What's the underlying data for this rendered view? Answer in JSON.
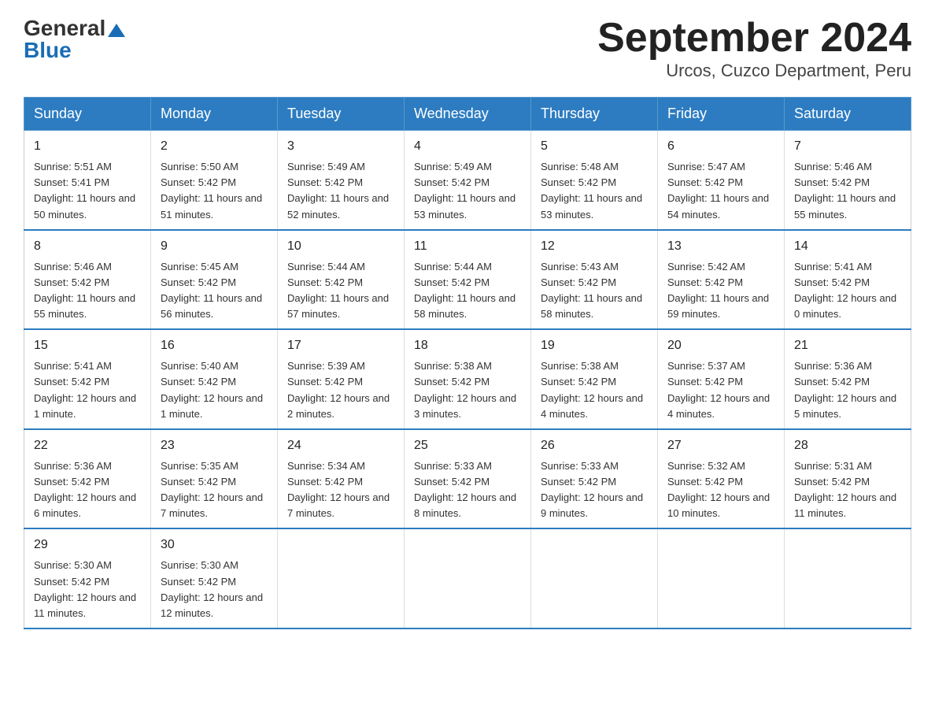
{
  "header": {
    "logo": {
      "text_general": "General",
      "triangle_alt": "blue triangle",
      "text_blue": "Blue"
    },
    "title": "September 2024",
    "subtitle": "Urcos, Cuzco Department, Peru"
  },
  "calendar": {
    "days_of_week": [
      "Sunday",
      "Monday",
      "Tuesday",
      "Wednesday",
      "Thursday",
      "Friday",
      "Saturday"
    ],
    "weeks": [
      [
        {
          "date": "1",
          "sunrise": "Sunrise: 5:51 AM",
          "sunset": "Sunset: 5:41 PM",
          "daylight": "Daylight: 11 hours and 50 minutes."
        },
        {
          "date": "2",
          "sunrise": "Sunrise: 5:50 AM",
          "sunset": "Sunset: 5:42 PM",
          "daylight": "Daylight: 11 hours and 51 minutes."
        },
        {
          "date": "3",
          "sunrise": "Sunrise: 5:49 AM",
          "sunset": "Sunset: 5:42 PM",
          "daylight": "Daylight: 11 hours and 52 minutes."
        },
        {
          "date": "4",
          "sunrise": "Sunrise: 5:49 AM",
          "sunset": "Sunset: 5:42 PM",
          "daylight": "Daylight: 11 hours and 53 minutes."
        },
        {
          "date": "5",
          "sunrise": "Sunrise: 5:48 AM",
          "sunset": "Sunset: 5:42 PM",
          "daylight": "Daylight: 11 hours and 53 minutes."
        },
        {
          "date": "6",
          "sunrise": "Sunrise: 5:47 AM",
          "sunset": "Sunset: 5:42 PM",
          "daylight": "Daylight: 11 hours and 54 minutes."
        },
        {
          "date": "7",
          "sunrise": "Sunrise: 5:46 AM",
          "sunset": "Sunset: 5:42 PM",
          "daylight": "Daylight: 11 hours and 55 minutes."
        }
      ],
      [
        {
          "date": "8",
          "sunrise": "Sunrise: 5:46 AM",
          "sunset": "Sunset: 5:42 PM",
          "daylight": "Daylight: 11 hours and 55 minutes."
        },
        {
          "date": "9",
          "sunrise": "Sunrise: 5:45 AM",
          "sunset": "Sunset: 5:42 PM",
          "daylight": "Daylight: 11 hours and 56 minutes."
        },
        {
          "date": "10",
          "sunrise": "Sunrise: 5:44 AM",
          "sunset": "Sunset: 5:42 PM",
          "daylight": "Daylight: 11 hours and 57 minutes."
        },
        {
          "date": "11",
          "sunrise": "Sunrise: 5:44 AM",
          "sunset": "Sunset: 5:42 PM",
          "daylight": "Daylight: 11 hours and 58 minutes."
        },
        {
          "date": "12",
          "sunrise": "Sunrise: 5:43 AM",
          "sunset": "Sunset: 5:42 PM",
          "daylight": "Daylight: 11 hours and 58 minutes."
        },
        {
          "date": "13",
          "sunrise": "Sunrise: 5:42 AM",
          "sunset": "Sunset: 5:42 PM",
          "daylight": "Daylight: 11 hours and 59 minutes."
        },
        {
          "date": "14",
          "sunrise": "Sunrise: 5:41 AM",
          "sunset": "Sunset: 5:42 PM",
          "daylight": "Daylight: 12 hours and 0 minutes."
        }
      ],
      [
        {
          "date": "15",
          "sunrise": "Sunrise: 5:41 AM",
          "sunset": "Sunset: 5:42 PM",
          "daylight": "Daylight: 12 hours and 1 minute."
        },
        {
          "date": "16",
          "sunrise": "Sunrise: 5:40 AM",
          "sunset": "Sunset: 5:42 PM",
          "daylight": "Daylight: 12 hours and 1 minute."
        },
        {
          "date": "17",
          "sunrise": "Sunrise: 5:39 AM",
          "sunset": "Sunset: 5:42 PM",
          "daylight": "Daylight: 12 hours and 2 minutes."
        },
        {
          "date": "18",
          "sunrise": "Sunrise: 5:38 AM",
          "sunset": "Sunset: 5:42 PM",
          "daylight": "Daylight: 12 hours and 3 minutes."
        },
        {
          "date": "19",
          "sunrise": "Sunrise: 5:38 AM",
          "sunset": "Sunset: 5:42 PM",
          "daylight": "Daylight: 12 hours and 4 minutes."
        },
        {
          "date": "20",
          "sunrise": "Sunrise: 5:37 AM",
          "sunset": "Sunset: 5:42 PM",
          "daylight": "Daylight: 12 hours and 4 minutes."
        },
        {
          "date": "21",
          "sunrise": "Sunrise: 5:36 AM",
          "sunset": "Sunset: 5:42 PM",
          "daylight": "Daylight: 12 hours and 5 minutes."
        }
      ],
      [
        {
          "date": "22",
          "sunrise": "Sunrise: 5:36 AM",
          "sunset": "Sunset: 5:42 PM",
          "daylight": "Daylight: 12 hours and 6 minutes."
        },
        {
          "date": "23",
          "sunrise": "Sunrise: 5:35 AM",
          "sunset": "Sunset: 5:42 PM",
          "daylight": "Daylight: 12 hours and 7 minutes."
        },
        {
          "date": "24",
          "sunrise": "Sunrise: 5:34 AM",
          "sunset": "Sunset: 5:42 PM",
          "daylight": "Daylight: 12 hours and 7 minutes."
        },
        {
          "date": "25",
          "sunrise": "Sunrise: 5:33 AM",
          "sunset": "Sunset: 5:42 PM",
          "daylight": "Daylight: 12 hours and 8 minutes."
        },
        {
          "date": "26",
          "sunrise": "Sunrise: 5:33 AM",
          "sunset": "Sunset: 5:42 PM",
          "daylight": "Daylight: 12 hours and 9 minutes."
        },
        {
          "date": "27",
          "sunrise": "Sunrise: 5:32 AM",
          "sunset": "Sunset: 5:42 PM",
          "daylight": "Daylight: 12 hours and 10 minutes."
        },
        {
          "date": "28",
          "sunrise": "Sunrise: 5:31 AM",
          "sunset": "Sunset: 5:42 PM",
          "daylight": "Daylight: 12 hours and 11 minutes."
        }
      ],
      [
        {
          "date": "29",
          "sunrise": "Sunrise: 5:30 AM",
          "sunset": "Sunset: 5:42 PM",
          "daylight": "Daylight: 12 hours and 11 minutes."
        },
        {
          "date": "30",
          "sunrise": "Sunrise: 5:30 AM",
          "sunset": "Sunset: 5:42 PM",
          "daylight": "Daylight: 12 hours and 12 minutes."
        },
        null,
        null,
        null,
        null,
        null
      ]
    ]
  }
}
